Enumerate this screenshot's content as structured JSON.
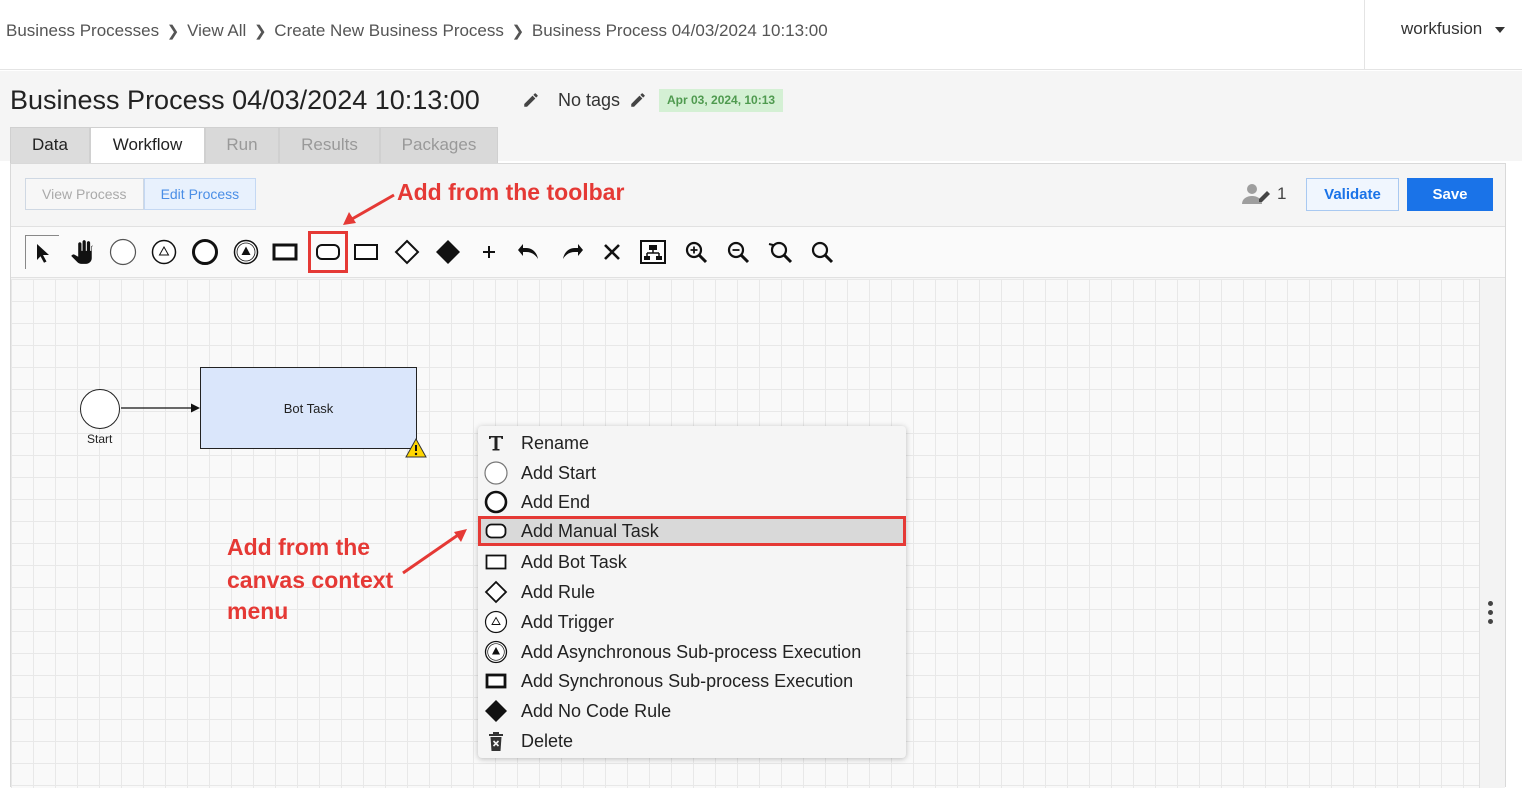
{
  "breadcrumb": [
    "Business Processes",
    "View All",
    "Create New Business Process",
    "Business Process 04/03/2024 10:13:00"
  ],
  "user": {
    "name": "workfusion"
  },
  "header": {
    "title": "Business Process 04/03/2024 10:13:00",
    "tags": "No tags",
    "date_badge": "Apr 03, 2024, 10:13"
  },
  "tabs": [
    {
      "label": "Data",
      "state": "normal"
    },
    {
      "label": "Workflow",
      "state": "active"
    },
    {
      "label": "Run",
      "state": "disabled"
    },
    {
      "label": "Results",
      "state": "disabled"
    },
    {
      "label": "Packages",
      "state": "disabled"
    }
  ],
  "modes": {
    "view": "View Process",
    "edit": "Edit Process",
    "active": "edit"
  },
  "collaborators": {
    "count": "1"
  },
  "actions": {
    "validate": "Validate",
    "save": "Save"
  },
  "toolbar": {
    "tools": [
      "pointer-icon",
      "hand-icon",
      "start-event-icon",
      "trigger-icon",
      "end-event-icon",
      "async-subprocess-icon",
      "sync-subprocess-icon",
      "manual-task-icon",
      "bot-task-icon",
      "rule-icon",
      "no-code-rule-icon",
      "plus-icon",
      "undo-icon",
      "redo-icon",
      "delete-icon",
      "auto-layout-icon",
      "zoom-in-icon",
      "zoom-out-icon",
      "zoom-reset-icon",
      "zoom-fit-icon"
    ],
    "highlighted": "manual-task-icon"
  },
  "diagram": {
    "start_label": "Start",
    "bot_task_label": "Bot Task"
  },
  "context_menu": {
    "items": [
      {
        "label": "Rename",
        "icon": "text-icon"
      },
      {
        "label": "Add Start",
        "icon": "start-event-icon"
      },
      {
        "label": "Add End",
        "icon": "end-event-icon"
      },
      {
        "label": "Add Manual Task",
        "icon": "manual-task-icon",
        "highlighted": true
      },
      {
        "label": "Add Bot Task",
        "icon": "bot-task-icon"
      },
      {
        "label": "Add Rule",
        "icon": "rule-icon"
      },
      {
        "label": "Add Trigger",
        "icon": "trigger-icon"
      },
      {
        "label": "Add Asynchronous Sub-process Execution",
        "icon": "async-subprocess-icon"
      },
      {
        "label": "Add Synchronous Sub-process Execution",
        "icon": "sync-subprocess-icon"
      },
      {
        "label": "Add No Code Rule",
        "icon": "no-code-rule-icon"
      },
      {
        "label": "Delete",
        "icon": "trash-icon"
      }
    ]
  },
  "annotations": {
    "toolbar_note": "Add from the toolbar",
    "menu_note_lines": [
      "Add from the",
      "canvas context",
      "menu"
    ],
    "color": "#e53935"
  },
  "colors": {
    "accent": "#1a73e8",
    "task_fill": "#dae6fb",
    "badge_bg": "#d4f0d4",
    "badge_text": "#4f9a4f"
  }
}
